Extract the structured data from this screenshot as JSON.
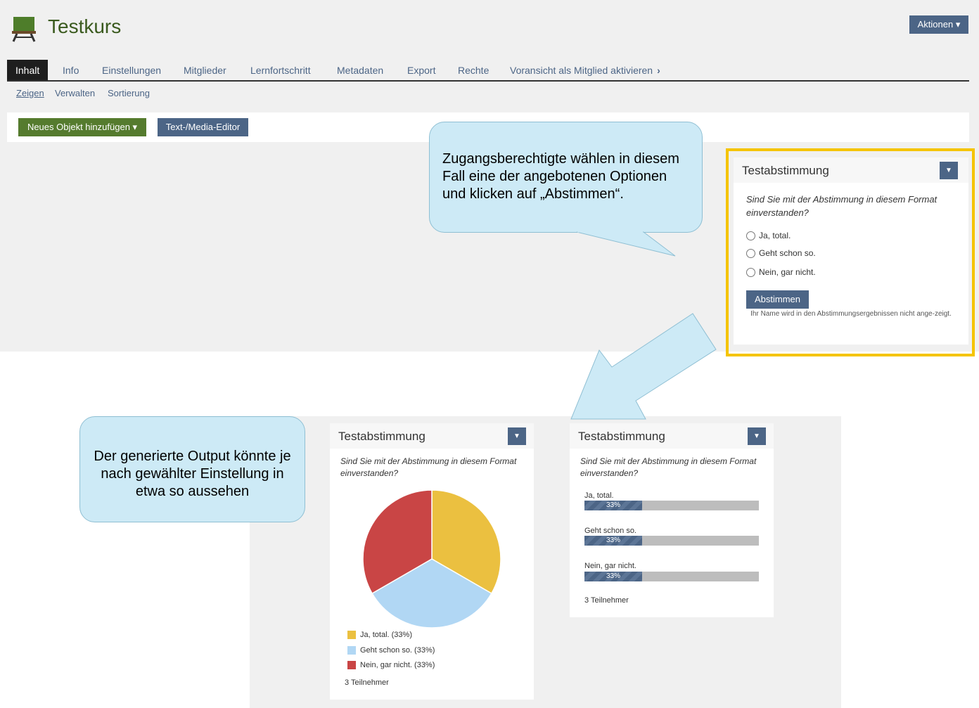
{
  "header": {
    "title": "Testkurs",
    "actions_label": "Aktionen ▾"
  },
  "tabs": [
    {
      "label": "Inhalt"
    },
    {
      "label": "Info"
    },
    {
      "label": "Einstellungen"
    },
    {
      "label": "Mitglieder"
    },
    {
      "label": "Lernfortschritt"
    },
    {
      "label": "Metadaten"
    },
    {
      "label": "Export"
    },
    {
      "label": "Rechte"
    },
    {
      "label": "Voransicht als Mitglied aktivieren"
    }
  ],
  "subtabs": [
    {
      "label": "Zeigen"
    },
    {
      "label": "Verwalten"
    },
    {
      "label": "Sortierung"
    }
  ],
  "toolbar": {
    "add_label": "Neues Objekt hinzufügen ▾",
    "editor_label": "Text-/Media-Editor"
  },
  "callouts": {
    "top": "Zugangsberechtigte wählen in diesem Fall eine der angebotenen Optionen und klicken auf „Abstimmen“.",
    "bottom": "Der generierte Output könnte je nach gewählter Einstellung in etwa so aussehen"
  },
  "poll": {
    "title": "Testabstimmung",
    "question": "Sind Sie mit der Abstimmung in diesem Format einverstanden?",
    "options": [
      "Ja, total.",
      "Geht schon so.",
      "Nein, gar nicht."
    ],
    "vote_label": "Abstimmen",
    "note": "Ihr Name wird in den Abstimmungsergebnissen nicht ange-zeigt."
  },
  "results": {
    "title": "Testabstimmung",
    "question": "Sind Sie mit der Abstimmung in diesem Format einverstanden?",
    "legend": [
      "Ja, total. (33%)",
      "Geht schon so. (33%)",
      "Nein, gar nicht. (33%)"
    ],
    "participants": "3 Teilnehmer",
    "bar_labels": [
      "Ja, total.",
      "Geht schon so.",
      "Nein, gar nicht."
    ],
    "bar_pct_labels": [
      "33%",
      "33%",
      "33%"
    ]
  },
  "chart_data": [
    {
      "type": "pie",
      "categories": [
        "Ja, total.",
        "Geht schon so.",
        "Nein, gar nicht."
      ],
      "values": [
        33,
        33,
        33
      ],
      "colors": [
        "#ebc040",
        "#b1d7f4",
        "#c94545"
      ]
    },
    {
      "type": "bar",
      "categories": [
        "Ja, total.",
        "Geht schon so.",
        "Nein, gar nicht."
      ],
      "values": [
        33,
        33,
        33
      ],
      "ylim": [
        0,
        100
      ]
    }
  ],
  "colors": {
    "accent": "#4c6586",
    "green": "#557b2e",
    "highlight": "#f5c400",
    "callout": "#cdeaf6"
  },
  "icons": {
    "course": "course-board-icon",
    "caret": "caret-down-icon",
    "chevron": "chevron-right-icon"
  }
}
